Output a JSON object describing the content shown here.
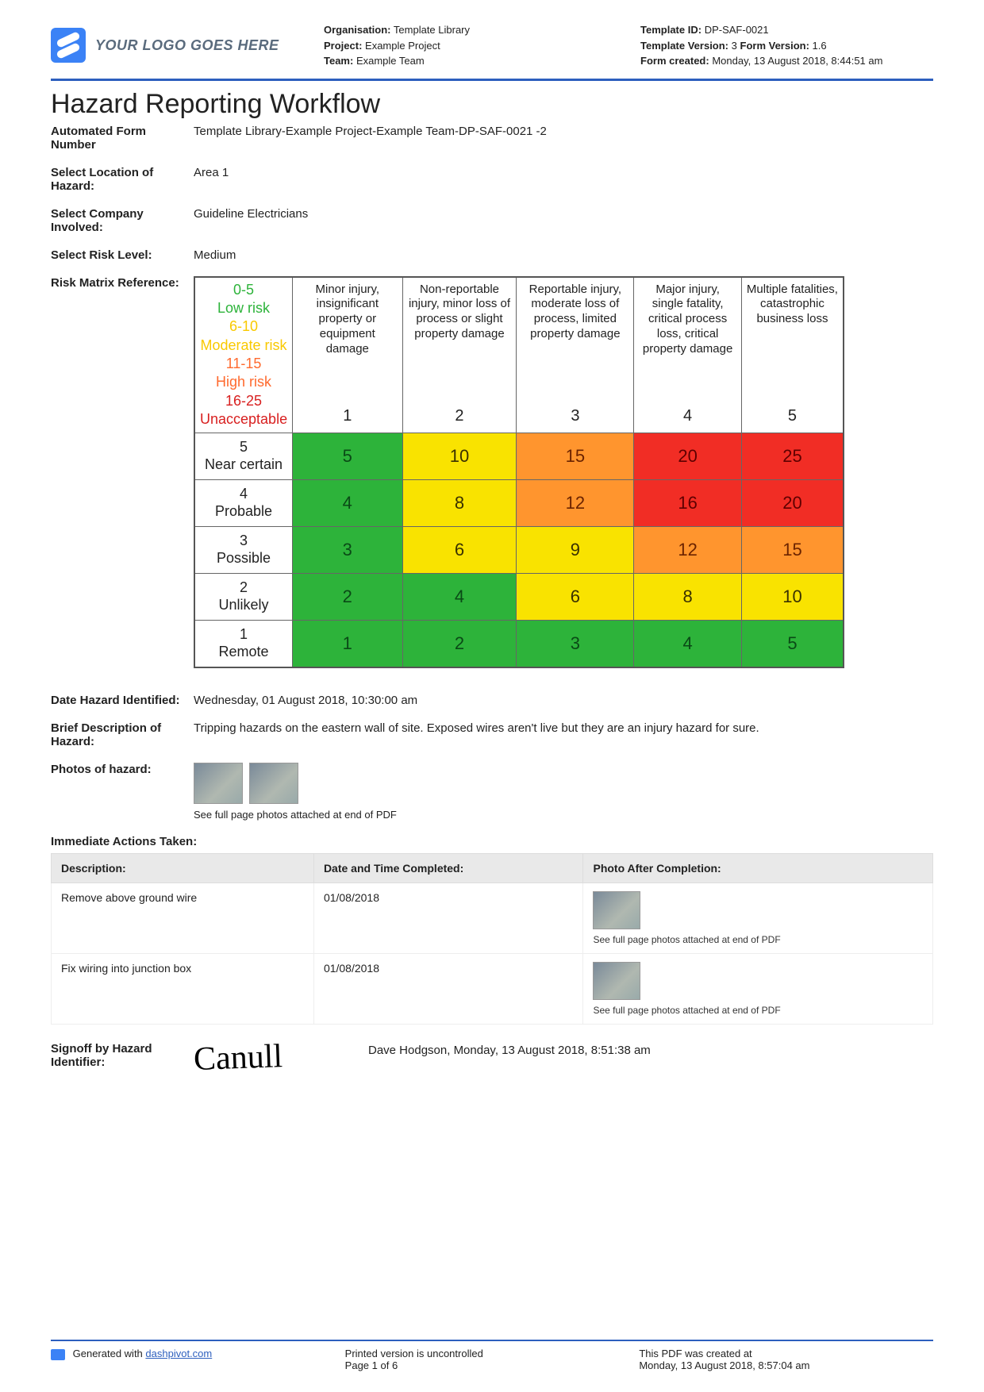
{
  "header": {
    "logo_text": "YOUR LOGO GOES HERE",
    "col1": {
      "org_label": "Organisation:",
      "org_value": "Template Library",
      "project_label": "Project:",
      "project_value": "Example Project",
      "team_label": "Team:",
      "team_value": "Example Team"
    },
    "col2": {
      "tid_label": "Template ID:",
      "tid_value": "DP-SAF-0021",
      "tver_label": "Template Version:",
      "tver_value": "3",
      "fver_label": "Form Version:",
      "fver_value": "1.6",
      "created_label": "Form created:",
      "created_value": "Monday, 13 August 2018, 8:44:51 am"
    }
  },
  "title": "Hazard Reporting Workflow",
  "fields": {
    "form_number_label": "Automated Form Number",
    "form_number_value": "Template Library-Example Project-Example Team-DP-SAF-0021   -2",
    "location_label": "Select Location of Hazard:",
    "location_value": "Area 1",
    "company_label": "Select Company Involved:",
    "company_value": "Guideline Electricians",
    "risk_label": "Select Risk Level:",
    "risk_value": "Medium",
    "matrix_label": "Risk Matrix Reference:",
    "date_label": "Date Hazard Identified:",
    "date_value": "Wednesday, 01 August 2018, 10:30:00 am",
    "desc_label": "Brief Description of Hazard:",
    "desc_value": "Tripping hazards on the eastern wall of site. Exposed wires aren't live but they are an injury hazard for sure.",
    "photos_label": "Photos of hazard:",
    "photos_note": "See full page photos attached at end of PDF",
    "signoff_label": "Signoff by Hazard Identifier:",
    "signoff_value": "Dave Hodgson, Monday, 13 August 2018, 8:51:38 am",
    "signature_text": "Canull"
  },
  "matrix": {
    "legend": [
      {
        "text": "0-5",
        "color": "#2db33a"
      },
      {
        "text": "Low risk",
        "color": "#2db33a"
      },
      {
        "text": "6-10",
        "color": "#f9c900"
      },
      {
        "text": "Moderate risk",
        "color": "#f9c900"
      },
      {
        "text": "11-15",
        "color": "#ff6a2e"
      },
      {
        "text": "High risk",
        "color": "#ff6a2e"
      },
      {
        "text": "16-25",
        "color": "#d81f1f"
      },
      {
        "text": "Unacceptable",
        "color": "#d81f1f"
      }
    ],
    "severity_headers": [
      "Minor injury, insignificant property or equipment damage",
      "Non-reportable injury, minor loss of process or slight property damage",
      "Reportable injury, moderate loss of process, limited property damage",
      "Major injury, single fatality, critical process loss, critical property damage",
      "Multiple fatalities, catastrophic business loss"
    ],
    "severity_nums": [
      "1",
      "2",
      "3",
      "4",
      "5"
    ],
    "rows": [
      {
        "label_num": "5",
        "label": "Near certain",
        "cells": [
          {
            "v": "5",
            "c": "green"
          },
          {
            "v": "10",
            "c": "yellow"
          },
          {
            "v": "15",
            "c": "orange"
          },
          {
            "v": "20",
            "c": "red"
          },
          {
            "v": "25",
            "c": "red"
          }
        ]
      },
      {
        "label_num": "4",
        "label": "Probable",
        "cells": [
          {
            "v": "4",
            "c": "green"
          },
          {
            "v": "8",
            "c": "yellow"
          },
          {
            "v": "12",
            "c": "orange"
          },
          {
            "v": "16",
            "c": "red"
          },
          {
            "v": "20",
            "c": "red"
          }
        ]
      },
      {
        "label_num": "3",
        "label": "Possible",
        "cells": [
          {
            "v": "3",
            "c": "green"
          },
          {
            "v": "6",
            "c": "yellow"
          },
          {
            "v": "9",
            "c": "yellow"
          },
          {
            "v": "12",
            "c": "orange"
          },
          {
            "v": "15",
            "c": "orange"
          }
        ]
      },
      {
        "label_num": "2",
        "label": "Unlikely",
        "cells": [
          {
            "v": "2",
            "c": "green"
          },
          {
            "v": "4",
            "c": "green"
          },
          {
            "v": "6",
            "c": "yellow"
          },
          {
            "v": "8",
            "c": "yellow"
          },
          {
            "v": "10",
            "c": "yellow"
          }
        ]
      },
      {
        "label_num": "1",
        "label": "Remote",
        "cells": [
          {
            "v": "1",
            "c": "green"
          },
          {
            "v": "2",
            "c": "green"
          },
          {
            "v": "3",
            "c": "green"
          },
          {
            "v": "4",
            "c": "green"
          },
          {
            "v": "5",
            "c": "green"
          }
        ]
      }
    ]
  },
  "actions": {
    "heading": "Immediate Actions Taken:",
    "cols": [
      "Description:",
      "Date and Time Completed:",
      "Photo After Completion:"
    ],
    "rows": [
      {
        "desc": "Remove above ground wire",
        "date": "01/08/2018",
        "note": "See full page photos attached at end of PDF"
      },
      {
        "desc": "Fix wiring into junction box",
        "date": "01/08/2018",
        "note": "See full page photos attached at end of PDF"
      }
    ]
  },
  "footer": {
    "gen_prefix": "Generated with ",
    "gen_link": "dashpivot.com",
    "uncontrolled": "Printed version is uncontrolled",
    "page": "Page 1 of 6",
    "created_label": "This PDF was created at",
    "created_value": "Monday, 13 August 2018, 8:57:04 am"
  }
}
